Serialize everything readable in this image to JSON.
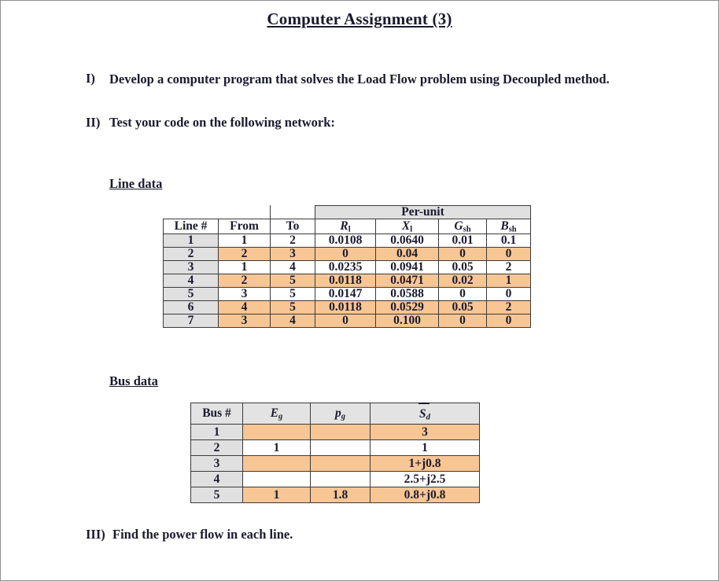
{
  "document": {
    "title": "Computer Assignment (3)"
  },
  "items": [
    {
      "marker": "I)",
      "text": "Develop a computer program that solves the Load Flow problem using Decoupled method."
    },
    {
      "marker": "II)",
      "text": "Test your code on the following network:"
    },
    {
      "marker": "III)",
      "text": "Find the power flow in each line."
    }
  ],
  "line_data": {
    "heading": "Line data",
    "group_header": "Per-unit",
    "columns": [
      "Line #",
      "From",
      "To",
      "R",
      "X",
      "G",
      "B"
    ],
    "column_subscripts": [
      "",
      "",
      "",
      "l",
      "l",
      "sh",
      "sh"
    ],
    "rows": [
      {
        "line": "1",
        "from": "1",
        "to": "2",
        "R": "0.0108",
        "X": "0.0640",
        "G": "0.01",
        "B": "0.1",
        "highlight": false
      },
      {
        "line": "2",
        "from": "2",
        "to": "3",
        "R": "0",
        "X": "0.04",
        "G": "0",
        "B": "0",
        "highlight": true
      },
      {
        "line": "3",
        "from": "1",
        "to": "4",
        "R": "0.0235",
        "X": "0.0941",
        "G": "0.05",
        "B": "2",
        "highlight": false
      },
      {
        "line": "4",
        "from": "2",
        "to": "5",
        "R": "0.0118",
        "X": "0.0471",
        "G": "0.02",
        "B": "1",
        "highlight": true
      },
      {
        "line": "5",
        "from": "3",
        "to": "5",
        "R": "0.0147",
        "X": "0.0588",
        "G": "0",
        "B": "0",
        "highlight": false
      },
      {
        "line": "6",
        "from": "4",
        "to": "5",
        "R": "0.0118",
        "X": "0.0529",
        "G": "0.05",
        "B": "2",
        "highlight": true
      },
      {
        "line": "7",
        "from": "3",
        "to": "4",
        "R": "0",
        "X": "0.100",
        "G": "0",
        "B": "0",
        "highlight": true
      }
    ]
  },
  "bus_data": {
    "heading": "Bus data",
    "columns": [
      "Bus #",
      "E",
      "p",
      "S"
    ],
    "column_subscripts": [
      "",
      "g",
      "g",
      "d"
    ],
    "rows": [
      {
        "bus": "1",
        "Eg": "",
        "pg": "",
        "Sd": "3",
        "highlight": true
      },
      {
        "bus": "2",
        "Eg": "1",
        "pg": "",
        "Sd": "1",
        "highlight": false
      },
      {
        "bus": "3",
        "Eg": "",
        "pg": "",
        "Sd": "1+j0.8",
        "highlight": true
      },
      {
        "bus": "4",
        "Eg": "",
        "pg": "",
        "Sd": "2.5+j2.5",
        "highlight": false
      },
      {
        "bus": "5",
        "Eg": "1",
        "pg": "1.8",
        "Sd": "0.8+j0.8",
        "highlight": true
      }
    ]
  },
  "colors": {
    "highlight": "#f8c694",
    "header_gray": "#e0e0e0",
    "text": "#1a1a2e",
    "border": "#3a3a3a"
  }
}
